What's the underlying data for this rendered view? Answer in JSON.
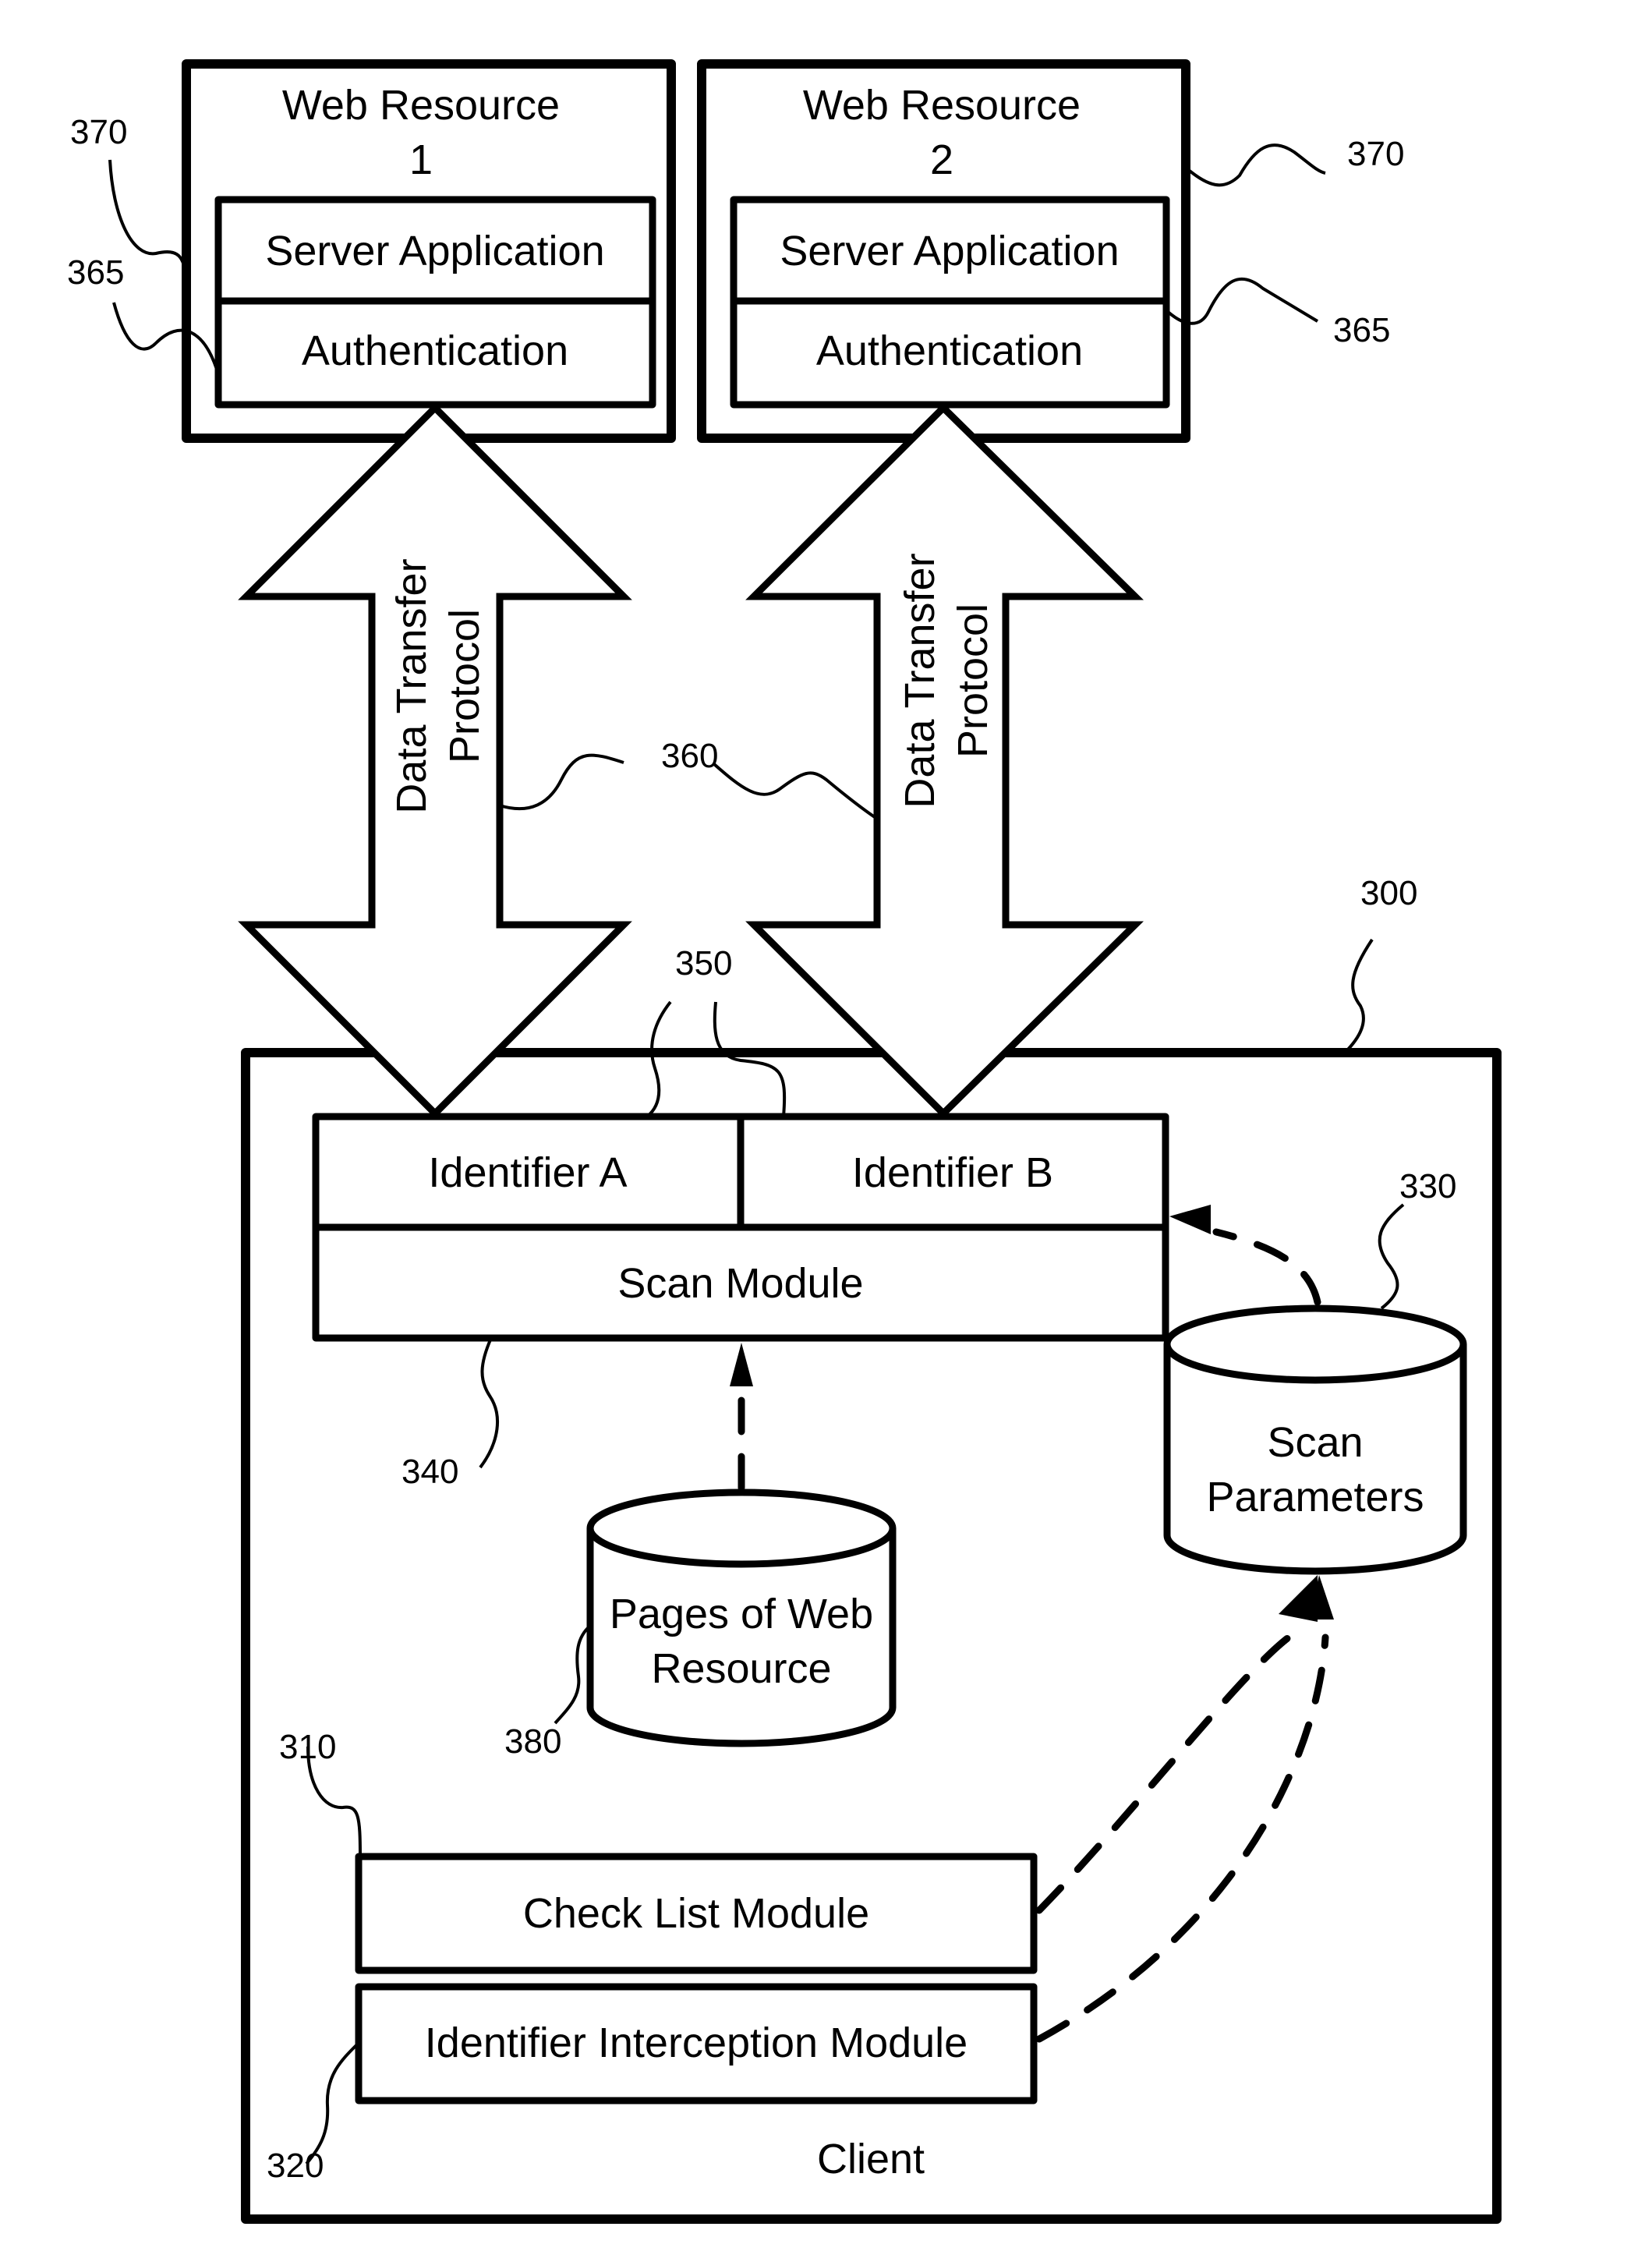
{
  "diagram": {
    "web_resources": [
      {
        "title_line1": "Web Resource",
        "title_line2": "1",
        "server_app": "Server Application",
        "auth": "Authentication",
        "ref_box": "370",
        "ref_auth": "365"
      },
      {
        "title_line1": "Web Resource",
        "title_line2": "2",
        "server_app": "Server Application",
        "auth": "Authentication",
        "ref_box": "370",
        "ref_auth": "365"
      }
    ],
    "arrows": [
      {
        "line1": "Data Transfer",
        "line2": "Protocol"
      },
      {
        "line1": "Data Transfer",
        "line2": "Protocol"
      }
    ],
    "ref_arrows": "360",
    "client": {
      "label": "Client",
      "ref": "300",
      "identifier_a": "Identifier A",
      "identifier_b": "Identifier B",
      "ref_identifiers": "350",
      "scan_module": "Scan Module",
      "ref_scan_module": "340",
      "scan_parameters_line1": "Scan",
      "scan_parameters_line2": "Parameters",
      "ref_scan_parameters": "330",
      "pages_line1": "Pages of Web",
      "pages_line2": "Resource",
      "ref_pages": "380",
      "check_list_module": "Check List Module",
      "ref_check_list": "310",
      "identifier_interception_module": "Identifier Interception Module",
      "ref_interception": "320"
    }
  }
}
